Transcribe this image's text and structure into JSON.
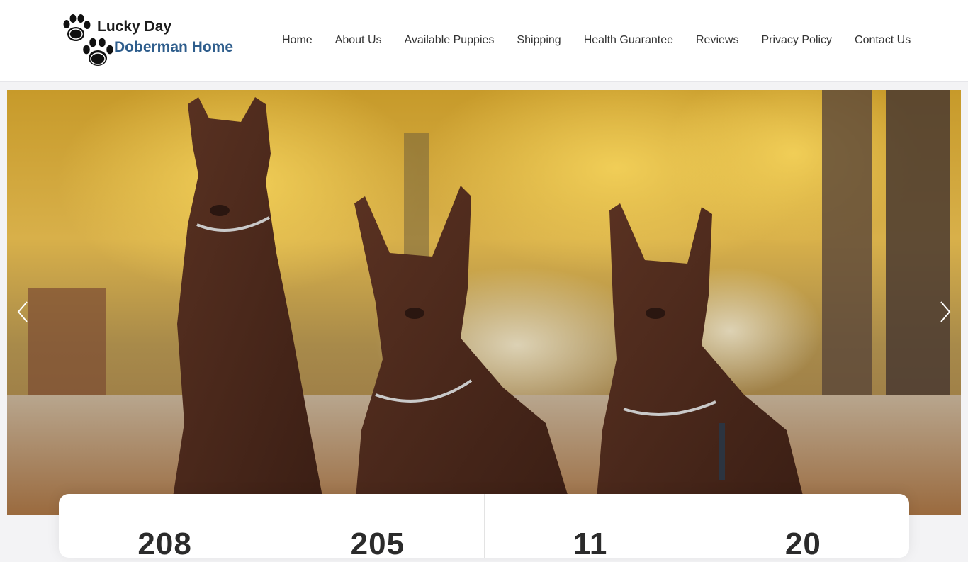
{
  "brand": {
    "line1": "Lucky Day",
    "line2": "Doberman Home",
    "line1_color": "#1c1c1c",
    "line2_color": "#2e5d8c",
    "icon": "paw-prints-icon"
  },
  "nav": {
    "items": [
      {
        "label": "Home"
      },
      {
        "label": "About Us"
      },
      {
        "label": "Available Puppies"
      },
      {
        "label": "Shipping"
      },
      {
        "label": "Health Guarantee"
      },
      {
        "label": "Reviews"
      },
      {
        "label": "Privacy Policy"
      },
      {
        "label": "Contact Us"
      }
    ]
  },
  "hero": {
    "image": "three-dobermans-autumn-park-photo",
    "prev_icon": "chevron-left-icon",
    "next_icon": "chevron-right-icon"
  },
  "stats": [
    {
      "number": "208"
    },
    {
      "number": "205"
    },
    {
      "number": "11"
    },
    {
      "number": "20"
    }
  ]
}
